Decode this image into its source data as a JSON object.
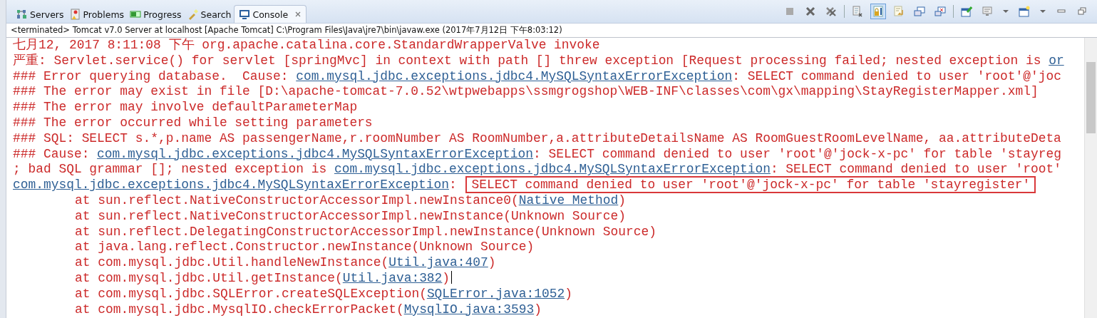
{
  "tabs": [
    {
      "label": "Servers",
      "kind": "servers",
      "selected": false,
      "closable": false
    },
    {
      "label": "Problems",
      "kind": "problems",
      "selected": false,
      "closable": false
    },
    {
      "label": "Progress",
      "kind": "progress",
      "selected": false,
      "closable": false
    },
    {
      "label": "Search",
      "kind": "search",
      "selected": false,
      "closable": false
    },
    {
      "label": "Console",
      "kind": "console",
      "selected": true,
      "closable": true
    }
  ],
  "toolbar": [
    {
      "kind": "stop",
      "selected": false
    },
    {
      "kind": "remove",
      "selected": false
    },
    {
      "kind": "remove-all",
      "selected": false
    },
    {
      "kind": "separator",
      "selected": false
    },
    {
      "kind": "clear",
      "selected": false
    },
    {
      "kind": "scroll-lock",
      "selected": true
    },
    {
      "kind": "word-wrap",
      "selected": false
    },
    {
      "kind": "stdout",
      "selected": false
    },
    {
      "kind": "stderr",
      "selected": false
    },
    {
      "kind": "separator",
      "selected": false
    },
    {
      "kind": "pin",
      "selected": false
    },
    {
      "kind": "display",
      "selected": false
    },
    {
      "kind": "dropdown",
      "selected": false
    },
    {
      "kind": "new-console",
      "selected": false
    },
    {
      "kind": "dropdown",
      "selected": false
    },
    {
      "kind": "minimize",
      "selected": false
    },
    {
      "kind": "maximize",
      "selected": false
    }
  ],
  "status": "<terminated> Tomcat v7.0 Server at localhost [Apache Tomcat] C:\\Program Files\\Java\\jre7\\bin\\javaw.exe (2017年7月12日 下午8:03:12)",
  "lines": [
    {
      "kind": "message",
      "segments": [
        {
          "text": "七月12, 2017 8:11:08 下午 org.apache.catalina.core.StandardWrapperValve invoke",
          "kind": "text"
        }
      ]
    },
    {
      "kind": "message",
      "segments": [
        {
          "text": "严重: Servlet.service() for servlet [springMvc] in context with path [] threw exception [Request processing failed; nested exception is ",
          "kind": "text"
        },
        {
          "text": "or",
          "kind": "link"
        }
      ]
    },
    {
      "kind": "message",
      "segments": [
        {
          "text": "### Error querying database.  Cause: ",
          "kind": "text"
        },
        {
          "text": "com.mysql.jdbc.exceptions.jdbc4.MySQLSyntaxErrorException",
          "kind": "link"
        },
        {
          "text": ": SELECT command denied to user 'root'@'joc",
          "kind": "text"
        }
      ]
    },
    {
      "kind": "message",
      "segments": [
        {
          "text": "### The error may exist in file [D:\\apache-tomcat-7.0.52\\wtpwebapps\\ssmgrogshop\\WEB-INF\\classes\\com\\gx\\mapping\\StayRegisterMapper.xml]",
          "kind": "text"
        }
      ]
    },
    {
      "kind": "message",
      "segments": [
        {
          "text": "### The error may involve defaultParameterMap",
          "kind": "text"
        }
      ]
    },
    {
      "kind": "message",
      "segments": [
        {
          "text": "### The error occurred while setting parameters",
          "kind": "text"
        }
      ]
    },
    {
      "kind": "message",
      "segments": [
        {
          "text": "### SQL: SELECT s.*,p.name AS passengerName,r.roomNumber AS RoomNumber,a.attributeDetailsName AS RoomGuestRoomLevelName, aa.attributeDeta",
          "kind": "text"
        }
      ]
    },
    {
      "kind": "message",
      "segments": [
        {
          "text": "### Cause: ",
          "kind": "text"
        },
        {
          "text": "com.mysql.jdbc.exceptions.jdbc4.MySQLSyntaxErrorException",
          "kind": "link"
        },
        {
          "text": ": SELECT command denied to user 'root'@'jock-x-pc' for table 'stayreg",
          "kind": "text"
        }
      ]
    },
    {
      "kind": "message",
      "segments": [
        {
          "text": "; bad SQL grammar []; nested exception is ",
          "kind": "text"
        },
        {
          "text": "com.mysql.jdbc.exceptions.jdbc4.MySQLSyntaxErrorException",
          "kind": "link"
        },
        {
          "text": ": SELECT command denied to user 'root'",
          "kind": "text"
        }
      ]
    },
    {
      "kind": "message",
      "segments": [
        {
          "text": "com.mysql.jdbc.exceptions.jdbc4.MySQLSyntaxErrorException",
          "kind": "link"
        },
        {
          "text": ": ",
          "kind": "text"
        },
        {
          "text": "SELECT command denied to user 'root'@'jock-x-pc' for table 'stayregister'",
          "kind": "highlight"
        }
      ]
    },
    {
      "kind": "frame",
      "segments": [
        {
          "text": "at sun.reflect.NativeConstructorAccessorImpl.newInstance0(",
          "kind": "text"
        },
        {
          "text": "Native Method",
          "kind": "link"
        },
        {
          "text": ")",
          "kind": "text"
        }
      ]
    },
    {
      "kind": "frame",
      "segments": [
        {
          "text": "at sun.reflect.NativeConstructorAccessorImpl.newInstance(Unknown Source)",
          "kind": "text"
        }
      ]
    },
    {
      "kind": "frame",
      "segments": [
        {
          "text": "at sun.reflect.DelegatingConstructorAccessorImpl.newInstance(Unknown Source)",
          "kind": "text"
        }
      ]
    },
    {
      "kind": "frame",
      "segments": [
        {
          "text": "at java.lang.reflect.Constructor.newInstance(Unknown Source)",
          "kind": "text"
        }
      ]
    },
    {
      "kind": "frame",
      "segments": [
        {
          "text": "at com.mysql.jdbc.Util.handleNewInstance(",
          "kind": "text"
        },
        {
          "text": "Util.java:407",
          "kind": "link"
        },
        {
          "text": ")",
          "kind": "text"
        }
      ]
    },
    {
      "kind": "frame",
      "caret": true,
      "segments": [
        {
          "text": "at com.mysql.jdbc.Util.getInstance(",
          "kind": "text"
        },
        {
          "text": "Util.java:382",
          "kind": "link"
        },
        {
          "text": ")",
          "kind": "text"
        }
      ]
    },
    {
      "kind": "frame",
      "segments": [
        {
          "text": "at com.mysql.jdbc.SQLError.createSQLException(",
          "kind": "text"
        },
        {
          "text": "SQLError.java:1052",
          "kind": "link"
        },
        {
          "text": ")",
          "kind": "text"
        }
      ]
    },
    {
      "kind": "frame",
      "segments": [
        {
          "text": "at com.mysql.jdbc.MysqlIO.checkErrorPacket(",
          "kind": "text"
        },
        {
          "text": "MysqlIO.java:3593",
          "kind": "link"
        },
        {
          "text": ")",
          "kind": "text"
        }
      ]
    }
  ]
}
